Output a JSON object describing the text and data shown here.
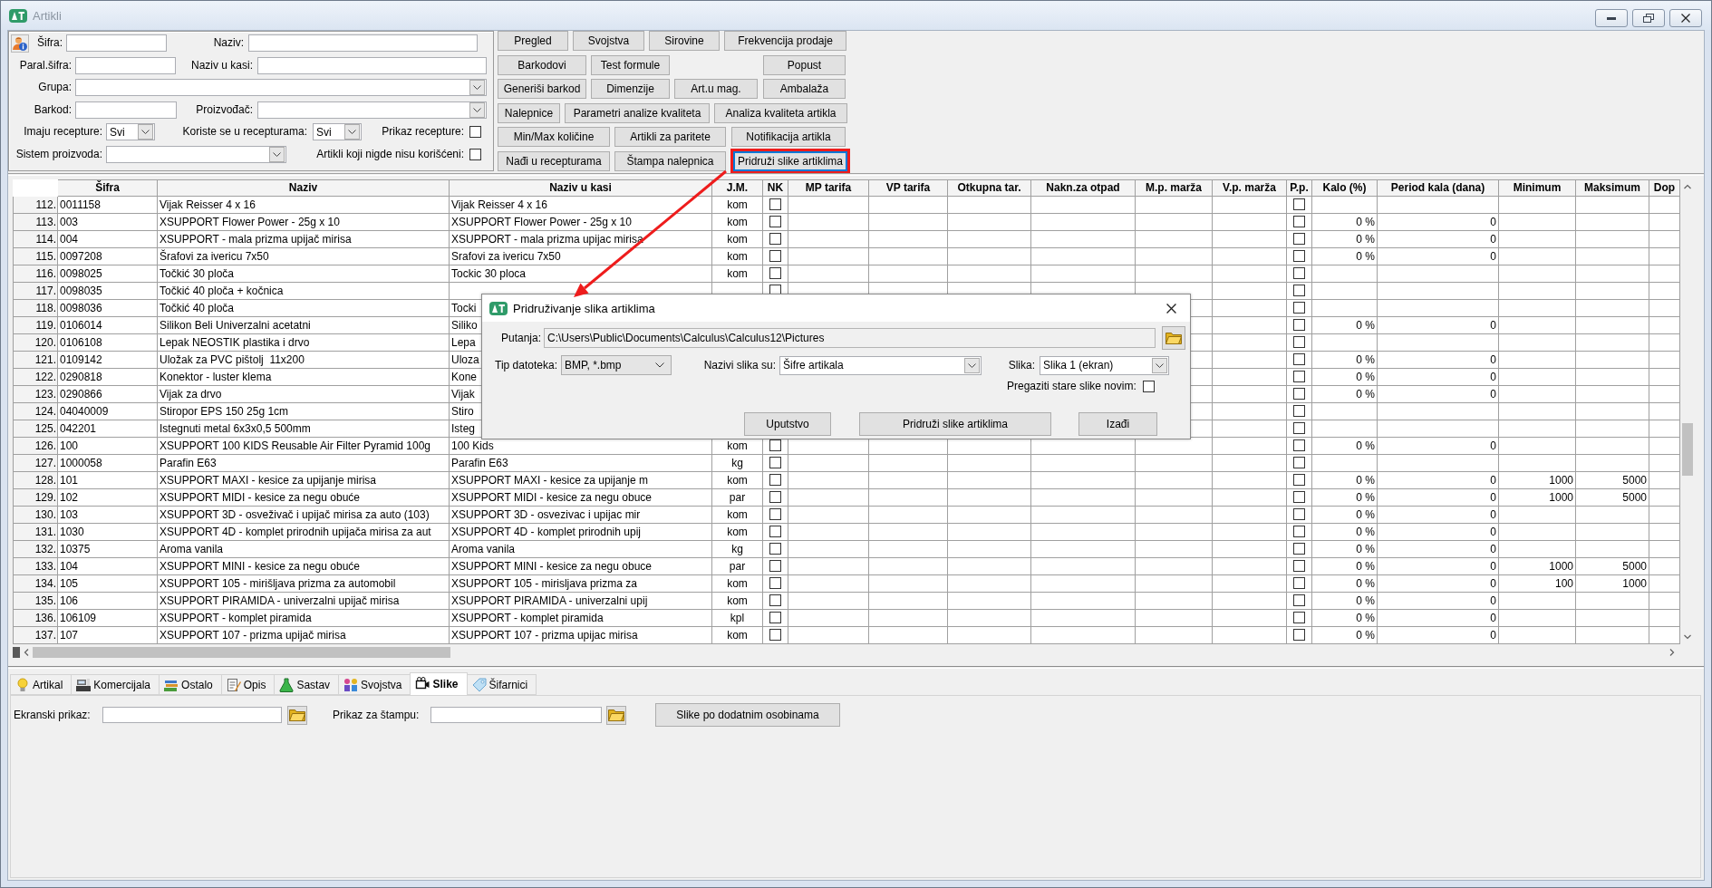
{
  "window": {
    "title": "Artikli"
  },
  "filters": {
    "sifra": {
      "label": "Šifra:"
    },
    "naziv": {
      "label": "Naziv:"
    },
    "paral_sifra": {
      "label": "Paral.šifra:"
    },
    "naziv_u_kasi": {
      "label": "Naziv u kasi:"
    },
    "grupa": {
      "label": "Grupa:"
    },
    "barkod": {
      "label": "Barkod:"
    },
    "proizvodjac": {
      "label": "Proizvođač:"
    },
    "imaju_recepture": {
      "label": "Imaju recepture:",
      "value": "Svi"
    },
    "koriste_se": {
      "label": "Koriste se u recepturama:",
      "value": "Svi"
    },
    "prikaz_recepture": {
      "label": "Prikaz recepture:",
      "checked": false
    },
    "sistem_proizvoda": {
      "label": "Sistem proizvoda:"
    },
    "nekorisceni": {
      "label": "Artikli koji nigde nisu korišćeni:",
      "checked": false
    }
  },
  "action_buttons": [
    [
      {
        "label": "Pregled",
        "focused": false,
        "highlighted": false
      },
      {
        "label": "Svojstva",
        "focused": false,
        "highlighted": false
      },
      {
        "label": "Sirovine",
        "focused": false,
        "highlighted": false
      },
      {
        "label": "Frekvencija prodaje",
        "focused": false,
        "highlighted": false
      }
    ],
    [
      {
        "label": "Barkodovi",
        "focused": false,
        "highlighted": false
      },
      {
        "label": "Test formule",
        "focused": false,
        "highlighted": false
      },
      {
        "label": "Popust",
        "focused": false,
        "highlighted": false
      }
    ],
    [
      {
        "label": "Generiši barkod",
        "focused": false,
        "highlighted": false
      },
      {
        "label": "Dimenzije",
        "focused": false,
        "highlighted": false
      },
      {
        "label": "Art.u mag.",
        "focused": false,
        "highlighted": false
      },
      {
        "label": "Ambalaža",
        "focused": false,
        "highlighted": false
      }
    ],
    [
      {
        "label": "Nalepnice",
        "focused": false,
        "highlighted": false
      },
      {
        "label": "Parametri analize kvaliteta",
        "focused": false,
        "highlighted": false
      },
      {
        "label": "Analiza kvaliteta artikla",
        "focused": false,
        "highlighted": false
      }
    ],
    [
      {
        "label": "Min/Max količine",
        "focused": false,
        "highlighted": false
      },
      {
        "label": "Artikli za paritete",
        "focused": false,
        "highlighted": false
      },
      {
        "label": "Notifikacija artikla",
        "focused": false,
        "highlighted": false
      }
    ],
    [
      {
        "label": "Nađi u recepturama",
        "focused": false,
        "highlighted": false
      },
      {
        "label": "Štampa nalepnica",
        "focused": false,
        "highlighted": false
      },
      {
        "label": "Pridruži slike artiklima",
        "focused": true,
        "highlighted": true
      }
    ]
  ],
  "table": {
    "columns": [
      "Šifra",
      "Naziv",
      "Naziv u kasi",
      "J.M.",
      "NK",
      "MP tarifa",
      "VP tarifa",
      "Otkupna tar.",
      "Nakn.za otpad",
      "M.p. marža",
      "V.p. marža",
      "P.p.",
      "Kalo (%)",
      "Period kala (dana)",
      "Minimum",
      "Maksimum",
      "Dop"
    ],
    "rows": [
      {
        "number": "112.",
        "sifra": "0011158",
        "naziv": "Vijak Reisser 4 x 16",
        "naziv_u_kasi": "Vijak Reisser 4 x 16",
        "jm": "kom",
        "nk": false,
        "pp": false
      },
      {
        "number": "113.",
        "sifra": "003",
        "naziv": "XSUPPORT Flower Power - 25g x 10",
        "naziv_u_kasi": "XSUPPORT Flower Power - 25g x 10",
        "jm": "kom",
        "nk": false,
        "pp": false,
        "kalo": "0 %",
        "period": "0"
      },
      {
        "number": "114.",
        "sifra": "004",
        "naziv": "XSUPPORT - mala prizma upijač mirisa",
        "naziv_u_kasi": "XSUPPORT - mala prizma upijac mirisa",
        "jm": "kom",
        "nk": false,
        "pp": false,
        "kalo": "0 %",
        "period": "0"
      },
      {
        "number": "115.",
        "sifra": "0097208",
        "naziv": "Šrafovi za ivericu 7x50",
        "naziv_u_kasi": "Srafovi za ivericu 7x50",
        "jm": "kom",
        "nk": false,
        "pp": false,
        "kalo": "0 %",
        "period": "0"
      },
      {
        "number": "116.",
        "sifra": "0098025",
        "naziv": "Točkić 30 ploča",
        "naziv_u_kasi": "Tockic 30 ploca",
        "jm": "kom",
        "nk": false,
        "pp": false
      },
      {
        "number": "117.",
        "sifra": "0098035",
        "naziv": "Točkić 40 ploča + kočnica",
        "nk": false,
        "pp": false
      },
      {
        "number": "118.",
        "sifra": "0098036",
        "naziv": "Točkić 40 ploča",
        "naziv_u_kasi": "Tocki",
        "pp": false
      },
      {
        "number": "119.",
        "sifra": "0106014",
        "naziv": "Silikon Beli Univerzalni acetatni",
        "naziv_u_kasi": "Siliko",
        "pp": false,
        "kalo": "0 %",
        "period": "0"
      },
      {
        "number": "120.",
        "sifra": "0106108",
        "naziv": "Lepak NEOSTIK plastika i drvo",
        "naziv_u_kasi": "Lepa",
        "pp": false
      },
      {
        "number": "121.",
        "sifra": "0109142",
        "naziv": "Uložak za PVC pištolj  11x200",
        "naziv_u_kasi": "Uloza",
        "pp": false,
        "kalo": "0 %",
        "period": "0"
      },
      {
        "number": "122.",
        "sifra": "0290818",
        "naziv": "Konektor - luster klema",
        "naziv_u_kasi": "Kone",
        "pp": false,
        "kalo": "0 %",
        "period": "0"
      },
      {
        "number": "123.",
        "sifra": "0290866",
        "naziv": "Vijak za drvo",
        "naziv_u_kasi": "Vijak",
        "pp": false,
        "kalo": "0 %",
        "period": "0"
      },
      {
        "number": "124.",
        "sifra": "04040009",
        "naziv": "Stiropor EPS 150 25g 1cm",
        "naziv_u_kasi": "Stiro",
        "pp": false
      },
      {
        "number": "125.",
        "sifra": "042201",
        "naziv": "Istegnuti metal 6x3x0,5 500mm",
        "naziv_u_kasi": "Isteg",
        "pp": false
      },
      {
        "number": "126.",
        "sifra": "100",
        "naziv": "XSUPPORT 100 KIDS Reusable Air Filter Pyramid 100g",
        "naziv_u_kasi": "100 Kids",
        "jm": "kom",
        "nk": false,
        "pp": false,
        "kalo": "0 %",
        "period": "0"
      },
      {
        "number": "127.",
        "sifra": "1000058",
        "naziv": "Parafin E63",
        "naziv_u_kasi": "Parafin E63",
        "jm": "kg",
        "nk": false,
        "pp": false
      },
      {
        "number": "128.",
        "sifra": "101",
        "naziv": "XSUPPORT MAXI - kesice za upijanje mirisa",
        "naziv_u_kasi": "XSUPPORT MAXI - kesice za upijanje m",
        "jm": "kom",
        "nk": false,
        "pp": false,
        "kalo": "0 %",
        "period": "0",
        "minimum": "1000",
        "maksimum": "5000"
      },
      {
        "number": "129.",
        "sifra": "102",
        "naziv": "XSUPPORT MIDI - kesice za negu obuće",
        "naziv_u_kasi": "XSUPPORT MIDI - kesice za negu obuce",
        "jm": "par",
        "nk": false,
        "pp": false,
        "kalo": "0 %",
        "period": "0",
        "minimum": "1000",
        "maksimum": "5000"
      },
      {
        "number": "130.",
        "sifra": "103",
        "naziv": "XSUPPORT 3D - osveživač i upijač mirisa za auto (103)",
        "naziv_u_kasi": "XSUPPORT 3D - osvezivac i upijac mir",
        "jm": "kom",
        "nk": false,
        "pp": false,
        "kalo": "0 %",
        "period": "0"
      },
      {
        "number": "131.",
        "sifra": "1030",
        "naziv": "XSUPPORT 4D - komplet prirodnih upijača mirisa za aut",
        "naziv_u_kasi": "XSUPPORT 4D - komplet prirodnih upij",
        "jm": "kom",
        "nk": false,
        "pp": false,
        "kalo": "0 %",
        "period": "0"
      },
      {
        "number": "132.",
        "sifra": "10375",
        "naziv": "Aroma vanila",
        "naziv_u_kasi": "Aroma vanila",
        "jm": "kg",
        "nk": false,
        "pp": false,
        "kalo": "0 %",
        "period": "0"
      },
      {
        "number": "133.",
        "sifra": "104",
        "naziv": "XSUPPORT MINI - kesice za negu obuće",
        "naziv_u_kasi": "XSUPPORT MINI - kesice za negu obuce",
        "jm": "par",
        "nk": false,
        "pp": false,
        "kalo": "0 %",
        "period": "0",
        "minimum": "1000",
        "maksimum": "5000"
      },
      {
        "number": "134.",
        "sifra": "105",
        "naziv": "XSUPPORT 105 - mirišljava prizma za automobil",
        "naziv_u_kasi": "XSUPPORT 105 - mirisljava prizma za",
        "jm": "kom",
        "nk": false,
        "pp": false,
        "kalo": "0 %",
        "period": "0",
        "minimum": "100",
        "maksimum": "1000"
      },
      {
        "number": "135.",
        "sifra": "106",
        "naziv": "XSUPPORT PIRAMIDA - univerzalni upijač mirisa",
        "naziv_u_kasi": "XSUPPORT PIRAMIDA - univerzalni upij",
        "jm": "kom",
        "nk": false,
        "pp": false,
        "kalo": "0 %",
        "period": "0"
      },
      {
        "number": "136.",
        "sifra": "106109",
        "naziv": "XSUPPORT - komplet piramida",
        "naziv_u_kasi": "XSUPPORT - komplet piramida",
        "jm": "kpl",
        "nk": false,
        "pp": false,
        "kalo": "0 %",
        "period": "0"
      },
      {
        "number": "137.",
        "sifra": "107",
        "naziv": "XSUPPORT 107 - prizma upijač mirisa",
        "naziv_u_kasi": "XSUPPORT 107 - prizma upijac mirisa",
        "jm": "kom",
        "nk": false,
        "pp": false,
        "kalo": "0 %",
        "period": "0"
      }
    ]
  },
  "tabs": [
    {
      "label": "Artikal",
      "selected": false
    },
    {
      "label": "Komercijala",
      "selected": false
    },
    {
      "label": "Ostalo",
      "selected": false
    },
    {
      "label": "Opis",
      "selected": false
    },
    {
      "label": "Sastav",
      "selected": false
    },
    {
      "label": "Svojstva",
      "selected": false
    },
    {
      "label": "Slike",
      "selected": true
    },
    {
      "label": "Šifarnici",
      "selected": false
    }
  ],
  "images_panel": {
    "screen_display": {
      "label": "Ekranski prikaz:"
    },
    "print_display": {
      "label": "Prikaz za štampu:"
    },
    "button": "Slike po dodatnim osobinama"
  },
  "dialog": {
    "title": "Pridruživanje slika artiklima",
    "path": {
      "label": "Putanja:",
      "value": "C:\\Users\\Public\\Documents\\Calculus\\Calculus12\\Pictures"
    },
    "file_type": {
      "label": "Tip datoteka:",
      "value": "BMP, *.bmp"
    },
    "image_names": {
      "label": "Nazivi slika su:",
      "value": "Šifre artikala"
    },
    "image": {
      "label": "Slika:",
      "value": "Slika 1 (ekran)"
    },
    "overwrite": {
      "label": "Pregaziti stare slike novim:",
      "checked": false
    },
    "buttons": [
      "Uputstvo",
      "Pridruži slike artiklima",
      "Izađi"
    ]
  }
}
